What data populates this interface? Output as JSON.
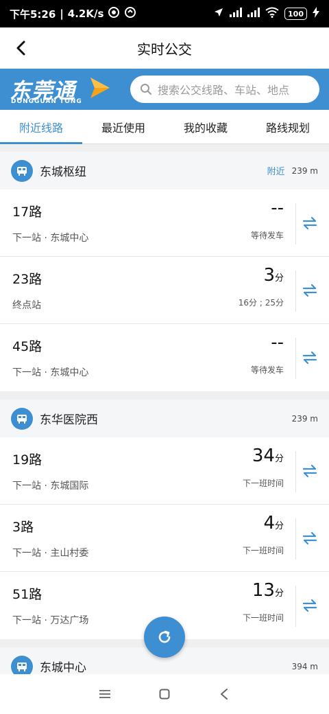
{
  "status_bar": {
    "time": "下午5:26",
    "speed": "4.2K/s",
    "battery": "100"
  },
  "header": {
    "title": "实时公交"
  },
  "brand": {
    "logo_cn": "东莞通",
    "logo_en": "DONGGUAN TONG",
    "search_placeholder": "搜索公交线路、车站、地点"
  },
  "tabs": [
    {
      "label": "附近线路",
      "active": true
    },
    {
      "label": "最近使用",
      "active": false
    },
    {
      "label": "我的收藏",
      "active": false
    },
    {
      "label": "路线规划",
      "active": false
    }
  ],
  "stops": [
    {
      "name": "东城枢纽",
      "tag": "附近",
      "distance": "239 m",
      "routes": [
        {
          "line": "17路",
          "next": "下一站 · 东城中心",
          "eta": "--",
          "unit": "",
          "sub": "等待发车"
        },
        {
          "line": "23路",
          "next": "终点站",
          "eta": "3",
          "unit": "分",
          "sub": "16分 ; 25分"
        },
        {
          "line": "45路",
          "next": "下一站 · 东城中心",
          "eta": "--",
          "unit": "",
          "sub": "等待发车"
        }
      ]
    },
    {
      "name": "东华医院西",
      "tag": "",
      "distance": "239 m",
      "routes": [
        {
          "line": "19路",
          "next": "下一站 · 东城国际",
          "eta": "34",
          "unit": "分",
          "sub": "下一班时间"
        },
        {
          "line": "3路",
          "next": "下一站 · 主山村委",
          "eta": "4",
          "unit": "分",
          "sub": "下一班时间"
        },
        {
          "line": "51路",
          "next": "下一站 · 万达广场",
          "eta": "13",
          "unit": "分",
          "sub": "下一班时间"
        }
      ]
    },
    {
      "name": "东城中心",
      "tag": "",
      "distance": "394 m",
      "routes": []
    }
  ],
  "colors": {
    "accent": "#3d8fd1",
    "status_bar": "#000000"
  },
  "icons": {
    "back": "chevron-left-icon",
    "search": "search-icon",
    "stop": "bus-stop-icon",
    "swap": "swap-direction-icon",
    "refresh": "refresh-icon"
  }
}
